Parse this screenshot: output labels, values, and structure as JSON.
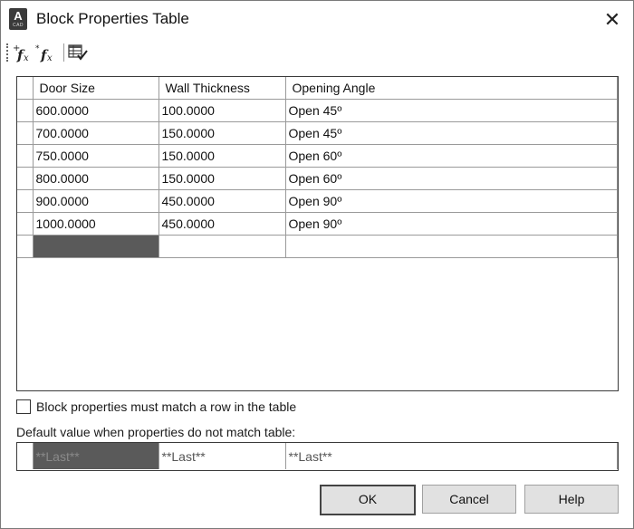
{
  "window": {
    "title": "Block Properties Table",
    "app_icon_letter": "A",
    "app_icon_sub": "CAD",
    "close_glyph": "✕"
  },
  "toolbar": {
    "buttons": [
      {
        "name": "add-properties-button",
        "icon": "add-fx-icon"
      },
      {
        "name": "add-user-parameter-button",
        "icon": "user-fx-icon"
      },
      {
        "name": "audit-table-button",
        "icon": "table-check-icon"
      }
    ]
  },
  "table": {
    "columns": [
      "Door Size",
      "Wall Thickness",
      "Opening Angle"
    ],
    "rows": [
      [
        "600.0000",
        "100.0000",
        "Open 45º"
      ],
      [
        "700.0000",
        "150.0000",
        "Open 45º"
      ],
      [
        "750.0000",
        "150.0000",
        "Open 60º"
      ],
      [
        "800.0000",
        "150.0000",
        "Open 60º"
      ],
      [
        "900.0000",
        "450.0000",
        "Open 90º"
      ],
      [
        "1000.0000",
        "450.0000",
        "Open 90º"
      ]
    ]
  },
  "must_match": {
    "label": "Block properties must match a row in the table",
    "checked": false
  },
  "defaults": {
    "label": "Default value when properties do not match table:",
    "values": [
      "**Last**",
      "**Last**",
      "**Last**"
    ]
  },
  "buttons": {
    "ok": "OK",
    "cancel": "Cancel",
    "help": "Help"
  },
  "colors": {
    "selected_cell": "#5a5a5a",
    "border": "#3a3a3a",
    "button_face": "#e1e1e1"
  }
}
